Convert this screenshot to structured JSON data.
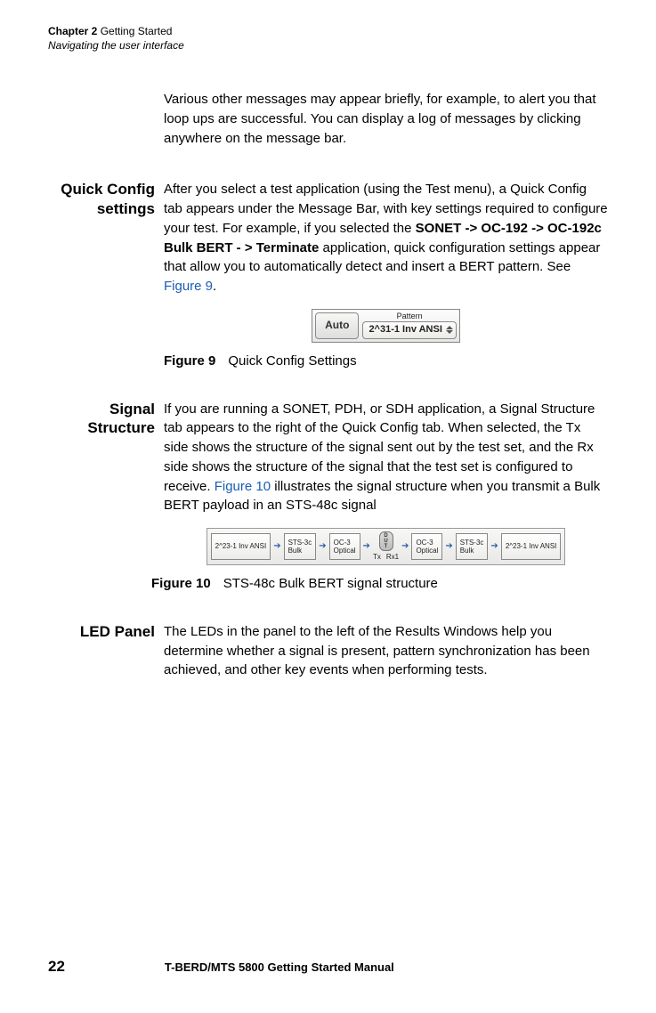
{
  "header": {
    "chapter_label": "Chapter 2",
    "chapter_title": "Getting Started",
    "section_title": "Navigating the user interface"
  },
  "intro": "Various other messages may appear briefly, for example, to alert you that loop ups are successful. You can display a log of messages by clicking anywhere on the message bar.",
  "quick_config": {
    "heading": "Quick Config settings",
    "body_pre": "After you select a test application (using the Test menu), a Quick Config tab appears under the Message Bar, with key settings required to configure your test. For example, if you selected the ",
    "body_bold": "SONET -> OC-192 -> OC-192c Bulk BERT - > Terminate",
    "body_mid": " application, quick configuration settings appear that allow you to automatically detect and insert a BERT pattern. See ",
    "link_text": "Figure 9",
    "body_post": ".",
    "widget": {
      "auto_label": "Auto",
      "pattern_label": "Pattern",
      "pattern_value": "2^31-1 Inv ANSI"
    },
    "figure_label": "Figure 9",
    "figure_caption": "Quick Config Settings"
  },
  "signal_structure": {
    "heading": "Signal Structure",
    "body_pre": "If you are running a SONET, PDH, or SDH application, a Signal Structure tab appears to the right of the Quick Config tab. When selected, the Tx side shows the structure of the signal sent out by the test set, and the Rx side shows the structure of the signal that the test set is configured to receive. ",
    "link_text": "Figure 10",
    "body_post": " illustrates the signal structure when you transmit a Bulk BERT payload in an STS-48c signal",
    "widget": {
      "left_pattern": "2^23-1 Inv ANSI",
      "sts_label1": "STS-3c",
      "sts_label2": "Bulk",
      "oc_label1": "OC-3",
      "oc_label2": "Optical",
      "tx_label": "Tx",
      "rx_label": "Rx1",
      "right_pattern": "2^23-1 Inv ANSI"
    },
    "figure_label": "Figure 10",
    "figure_caption": "STS-48c Bulk BERT signal structure"
  },
  "led_panel": {
    "heading": "LED Panel",
    "body": "The LEDs in the panel to the left of the Results Windows help you determine whether a signal is present, pattern synchronization has been achieved, and other key events when performing tests."
  },
  "footer": {
    "page_number": "22",
    "manual_title": "T-BERD/MTS 5800 Getting Started Manual"
  }
}
